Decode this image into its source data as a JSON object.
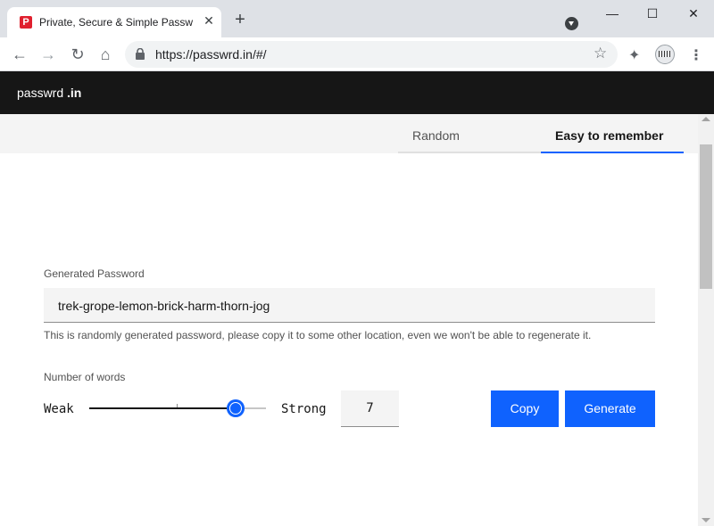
{
  "browser": {
    "tab_title": "Private, Secure & Simple Passw",
    "url": "https://passwrd.in/#/"
  },
  "site": {
    "brand_name": "passwrd",
    "brand_suffix": ".in"
  },
  "tabs": [
    {
      "label": "Random",
      "active": false
    },
    {
      "label": "Easy to remember",
      "active": true
    }
  ],
  "password": {
    "label": "Generated Password",
    "value": "trek-grope-lemon-brick-harm-thorn-jog",
    "helper": "This is randomly generated password, please copy it to some other location, even we won't be able to regenerate it."
  },
  "words": {
    "label": "Number of words",
    "weak_label": "Weak",
    "strong_label": "Strong",
    "value": "7",
    "slider_fraction": 0.83
  },
  "buttons": {
    "copy": "Copy",
    "generate": "Generate"
  },
  "colors": {
    "accent": "#0f62fe",
    "header_bg": "#161616",
    "favicon": "#e0202e"
  }
}
